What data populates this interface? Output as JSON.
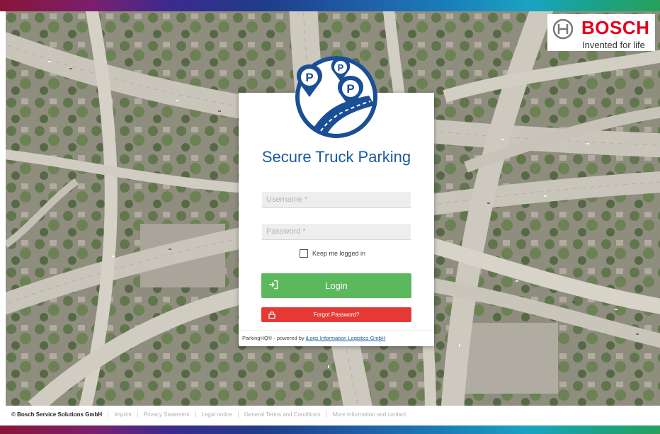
{
  "brand": {
    "name": "BOSCH",
    "tagline": "Invented for life",
    "mark_icon": "bosch-armature-icon"
  },
  "app": {
    "title": "Secure Truck Parking",
    "logo_icon": "parking-pins-road-icon",
    "logo_letters": [
      "P",
      "P",
      "P"
    ]
  },
  "login_form": {
    "username_placeholder": "Username *",
    "password_placeholder": "Password *",
    "remember_label": "Keep me logged in",
    "remember_checked": false,
    "login_label": "Login",
    "login_icon": "sign-in-icon",
    "forgot_label": "Forgot Password?",
    "forgot_icon": "lock-icon"
  },
  "powered_by": {
    "text": "ParkingHQ® - powered by ",
    "link": "iLogs Information Logistics GmbH"
  },
  "footer": {
    "copyright": "© Bosch Service Solutions GmbH",
    "links": [
      "Imprint",
      "Privacy Statement",
      "Legal notice",
      "General Terms and Conditions",
      "More information and contact"
    ]
  },
  "colors": {
    "brand_red": "#e2001a",
    "title_blue": "#1a5aa0",
    "login_green": "#5cb85c",
    "forgot_red": "#e53935"
  },
  "background_image": "aerial-highway-interchange"
}
